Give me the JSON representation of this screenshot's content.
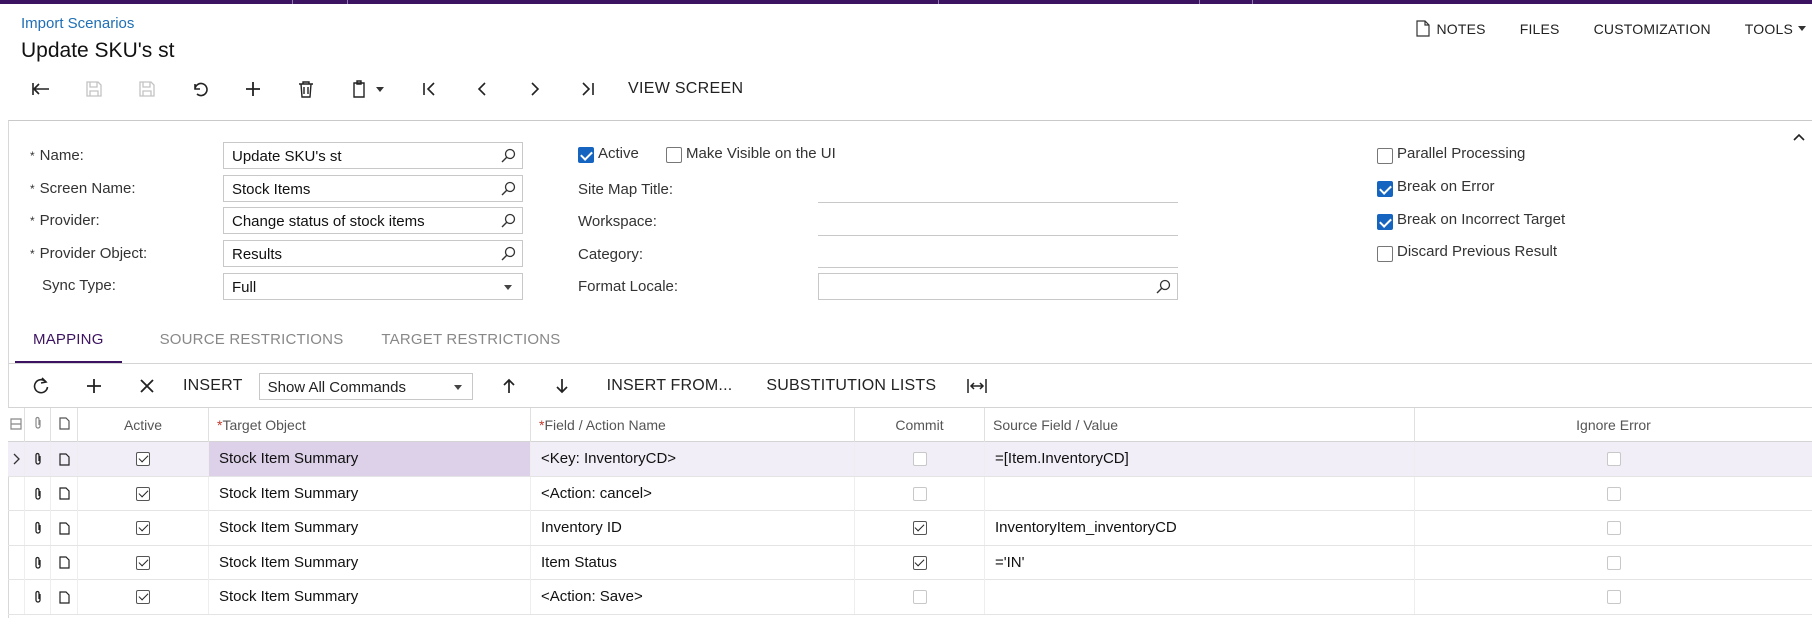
{
  "breadcrumb": "Import Scenarios",
  "title": "Update SKU's st",
  "top_menu": {
    "notes": "NOTES",
    "files": "FILES",
    "customization": "CUSTOMIZATION",
    "tools": "TOOLS"
  },
  "toolbar": {
    "view_screen": "VIEW SCREEN"
  },
  "form": {
    "name_label": "Name:",
    "name_value": "Update SKU's st",
    "screen_label": "Screen Name:",
    "screen_value": "Stock Items",
    "provider_label": "Provider:",
    "provider_value": "Change status of stock items",
    "provider_object_label": "Provider Object:",
    "provider_object_value": "Results",
    "sync_type_label": "Sync Type:",
    "sync_type_value": "Full",
    "active_label": "Active",
    "active_checked": true,
    "make_visible_label": "Make Visible on the UI",
    "make_visible_checked": false,
    "site_map_title_label": "Site Map Title:",
    "workspace_label": "Workspace:",
    "category_label": "Category:",
    "format_locale_label": "Format Locale:",
    "parallel_label": "Parallel Processing",
    "parallel_checked": false,
    "break_error_label": "Break on Error",
    "break_error_checked": true,
    "break_target_label": "Break on Incorrect Target",
    "break_target_checked": true,
    "discard_label": "Discard Previous Result",
    "discard_checked": false
  },
  "tabs": [
    "MAPPING",
    "SOURCE RESTRICTIONS",
    "TARGET RESTRICTIONS"
  ],
  "grid_toolbar": {
    "insert": "INSERT",
    "commands_select": "Show All Commands",
    "insert_from": "INSERT FROM...",
    "substitution_lists": "SUBSTITUTION LISTS"
  },
  "grid": {
    "headers": {
      "active": "Active",
      "target_object": "Target Object",
      "field_action": "Field / Action Name",
      "commit": "Commit",
      "source_field": "Source Field / Value",
      "ignore_error": "Ignore Error"
    },
    "rows": [
      {
        "active": true,
        "target": "Stock Item Summary",
        "field": "<Key: InventoryCD>",
        "commit": false,
        "source": "=[Item.InventoryCD]",
        "ignore": false
      },
      {
        "active": true,
        "target": "Stock Item Summary",
        "field": "<Action: cancel>",
        "commit": false,
        "source": "",
        "ignore": false
      },
      {
        "active": true,
        "target": "Stock Item Summary",
        "field": "Inventory ID",
        "commit": true,
        "source": "InventoryItem_inventoryCD",
        "ignore": false
      },
      {
        "active": true,
        "target": "Stock Item Summary",
        "field": "Item Status",
        "commit": true,
        "source": "='IN'",
        "ignore": false
      },
      {
        "active": true,
        "target": "Stock Item Summary",
        "field": "<Action: Save>",
        "commit": false,
        "source": "",
        "ignore": false
      }
    ]
  },
  "colors": {
    "brand": "#3c1361",
    "link": "#1f6fb5",
    "checkbox": "#1565c0"
  }
}
